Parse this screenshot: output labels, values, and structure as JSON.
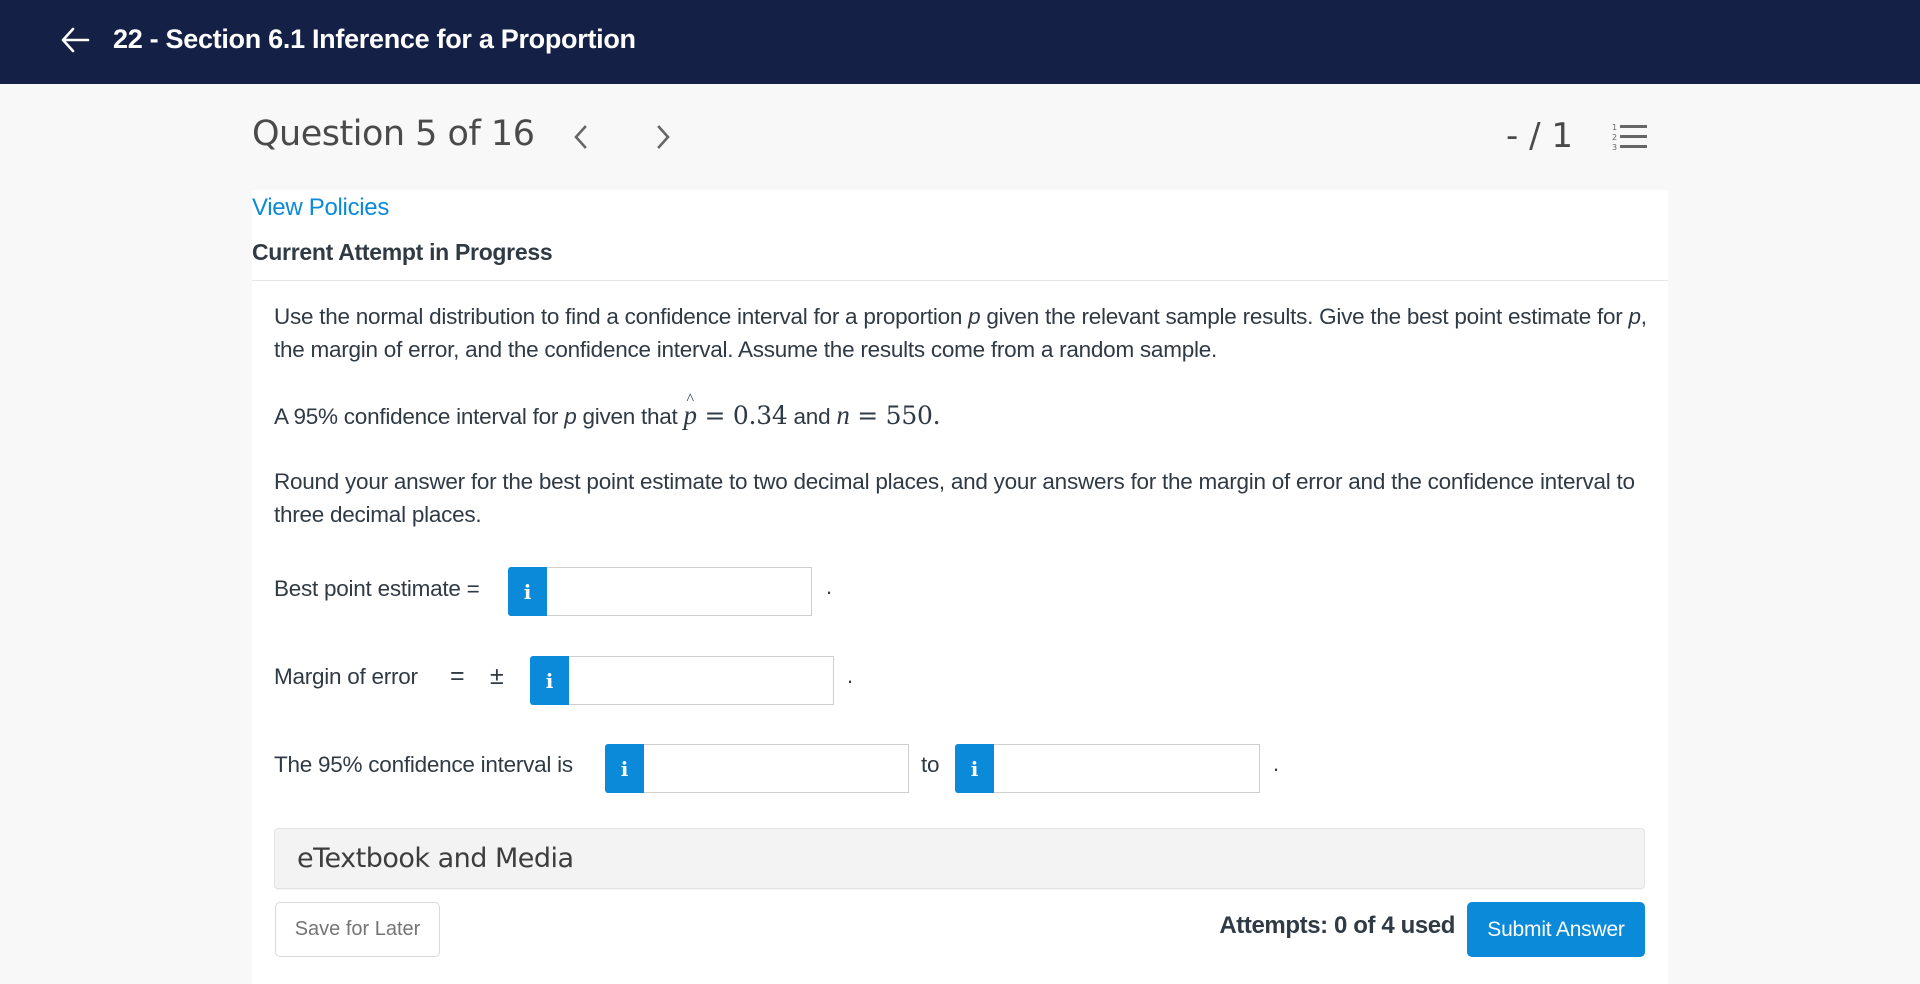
{
  "header": {
    "back_icon": "arrow-left-icon",
    "title": "22 - Section 6.1 Inference for a Proportion"
  },
  "question_nav": {
    "title": "Question 5 of 16",
    "prev_icon": "chevron-left-icon",
    "next_icon": "chevron-right-icon",
    "score": "- / 1",
    "question_list_icon": "numbered-list-icon"
  },
  "panel": {
    "view_policies": "View Policies",
    "attempt_heading": "Current Attempt in Progress"
  },
  "question": {
    "intro_1": "Use the normal distribution to find a confidence interval for a proportion ",
    "intro_var": "p",
    "intro_2": " given the relevant sample results. Give the best point estimate for ",
    "intro_var2": "p",
    "intro_3": ", the margin of error, and the confidence interval. Assume the results come from a random sample.",
    "given_1": "A 95% confidence interval for ",
    "given_var": "p",
    "given_2": " given that ",
    "phat_symbol": "p",
    "phat_hat": "^",
    "phat_value": " = 0.34",
    "given_and": " and ",
    "n_symbol": "n",
    "n_value": " = 550.",
    "rounding": "Round your answer for the best point estimate to two decimal places, and your answers for the margin of error and the confidence interval to three decimal places."
  },
  "answers": {
    "point_estimate_label": "Best point estimate =",
    "point_estimate_value": "",
    "margin_label": "Margin of error",
    "margin_equals": "=",
    "margin_pm": "±",
    "margin_value": "",
    "ci_label": "The 95% confidence interval is",
    "ci_lower_value": "",
    "ci_to": "to",
    "ci_upper_value": "",
    "info_glyph": "i",
    "period": "."
  },
  "resources": {
    "etextbook_label": "eTextbook and Media"
  },
  "footer": {
    "save_label": "Save for Later",
    "attempts_text": "Attempts: 0 of 4 used",
    "submit_label": "Submit Answer"
  },
  "colors": {
    "header_bg": "#152046",
    "accent": "#0a8ad8",
    "page_bg": "#f8f8f8",
    "text": "#2f3a45"
  }
}
